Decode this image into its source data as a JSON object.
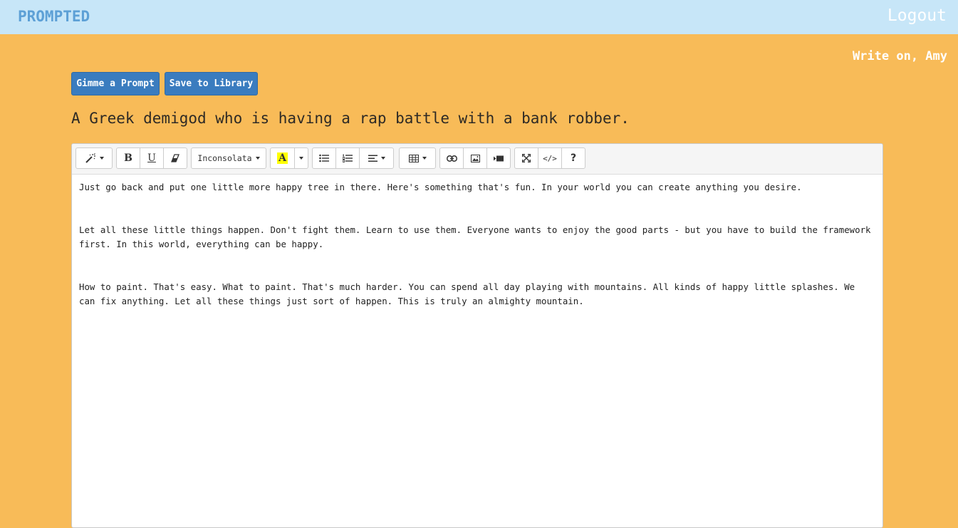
{
  "header": {
    "brand": "PROMPTED",
    "logout_label": "Logout"
  },
  "greeting": "Write on, Amy",
  "actions": {
    "prompt_label": "Gimme a Prompt",
    "save_label": "Save to Library"
  },
  "prompt": "A Greek demigod who is having a rap battle with a bank robber.",
  "toolbar": {
    "font_name": "Inconsolata",
    "help_label": "?",
    "code_label": "</>",
    "bold_label": "B",
    "underline_label": "U",
    "highlight_label": "A"
  },
  "editor": {
    "paragraphs": [
      "Just go back and put one little more happy tree in there. Here's something that's fun. In your world you can create anything you desire.",
      "Let all these little things happen. Don't fight them. Learn to use them. Everyone wants to enjoy the good parts - but you have to build the framework first. In this world, everything can be happy.",
      "How to paint. That's easy. What to paint. That's much harder. You can spend all day playing with mountains. All kinds of happy little splashes. We can fix anything. Let all these things just sort of happen. This is truly an almighty mountain."
    ]
  },
  "colors": {
    "page_background": "#f8bb58",
    "header_background": "#c7e6f8",
    "brand": "#5da0d6",
    "primary_button": "#3a7cbf",
    "highlight_swatch": "#ffff00"
  }
}
